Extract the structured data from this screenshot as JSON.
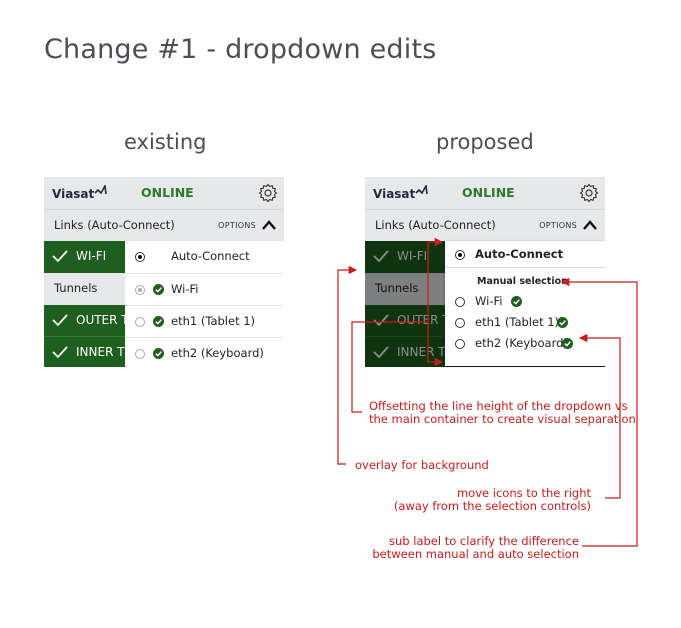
{
  "title": "Change #1 - dropdown edits",
  "existing": {
    "heading": "existing",
    "logo": "Viasat",
    "status": "ONLINE",
    "links_label": "Links (Auto-Connect)",
    "options_label": "OPTIONS",
    "rows": [
      "WI-FI",
      "Tunnels",
      "OUTER T",
      "INNER T"
    ],
    "dropdown": {
      "auto": "Auto-Connect",
      "items": [
        "Wi-Fi",
        "eth1 (Tablet 1)",
        "eth2 (Keyboard)"
      ]
    }
  },
  "proposed": {
    "heading": "proposed",
    "logo": "Viasat",
    "status": "ONLINE",
    "links_label": "Links (Auto-Connect)",
    "options_label": "OPTIONS",
    "rows": [
      "WI-FI",
      "Tunnels",
      "OUTER T",
      "INNER T"
    ],
    "dropdown": {
      "auto": "Auto-Connect",
      "sub_label": "Manual selection",
      "items": [
        "Wi-Fi",
        "eth1 (Tablet 1)",
        "eth2 (Keyboard)"
      ]
    }
  },
  "annotations": {
    "offset_line1": "Offsetting the line height of the dropdown vs",
    "offset_line2": "the main container to create visual separation",
    "overlay": "overlay for background",
    "icons_line1": "move icons to the right",
    "icons_line2": "(away from the selection controls)",
    "sublabel_line1": "sub label to clarify the difference",
    "sublabel_line2": "between manual and auto selection"
  },
  "colors": {
    "accent_green": "#1e5e1e",
    "status_green": "#2a7a2a",
    "annotation_red": "#cc1a1a",
    "header_grey": "#e6e8ea"
  },
  "icons": [
    "gear-icon",
    "chevron-up-icon",
    "check-icon",
    "check-circle-icon",
    "radio-icon"
  ]
}
